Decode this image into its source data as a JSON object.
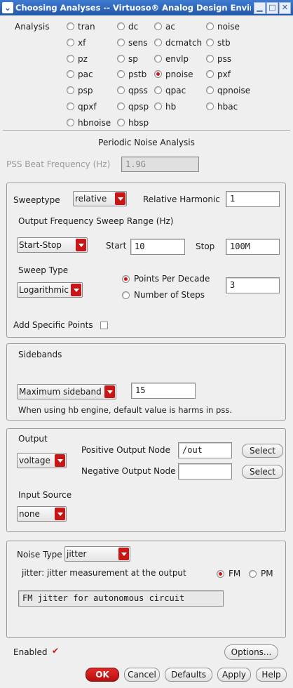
{
  "window": {
    "title": "Choosing Analyses -- Virtuoso® Analog Design Environment",
    "menu_icon": "chevron-down-icon",
    "btn_minimize": "▁",
    "btn_maximize": "□",
    "btn_close": "✕"
  },
  "analysis": {
    "label": "Analysis",
    "options": [
      "tran",
      "dc",
      "ac",
      "noise",
      "xf",
      "sens",
      "dcmatch",
      "stb",
      "pz",
      "sp",
      "envlp",
      "pss",
      "pac",
      "pstb",
      "pnoise",
      "pxf",
      "psp",
      "qpss",
      "qpac",
      "qpnoise",
      "qpxf",
      "qpsp",
      "hb",
      "hbac",
      "hbnoise",
      "hbsp"
    ],
    "selected": "pnoise"
  },
  "section_title": "Periodic Noise Analysis",
  "pss_beat": {
    "label": "PSS Beat Frequency (Hz)",
    "value": "1.9G"
  },
  "sweep": {
    "sweeptype_label": "Sweeptype",
    "sweeptype_value": "relative",
    "relative_harmonic_label": "Relative Harmonic",
    "relative_harmonic_value": "1",
    "range_label": "Output Frequency Sweep Range (Hz)",
    "range_mode": "Start-Stop",
    "start_label": "Start",
    "start_value": "10",
    "stop_label": "Stop",
    "stop_value": "100M",
    "sweep_type_label": "Sweep Type",
    "sweep_type_value": "Logarithmic",
    "points_per_decade_label": "Points Per Decade",
    "number_of_steps_label": "Number of Steps",
    "points_value": "3",
    "step_mode_selected": "points_per_decade",
    "add_points_label": "Add Specific Points",
    "add_points_checked": false
  },
  "sidebands": {
    "label": "Sidebands",
    "mode": "Maximum sideband",
    "value": "15",
    "note": "When using hb engine, default value is harms in pss."
  },
  "output": {
    "label": "Output",
    "type": "voltage",
    "pos_label": "Positive Output Node",
    "pos_value": "/out",
    "neg_label": "Negative Output Node",
    "neg_value": "",
    "select_label": "Select",
    "input_source_label": "Input Source",
    "input_source_value": "none"
  },
  "noise": {
    "type_label": "Noise Type",
    "type_value": "jitter",
    "description": "jitter: jitter measurement at the output",
    "fm_label": "FM",
    "pm_label": "PM",
    "modulation_selected": "FM",
    "note_field": "FM jitter for autonomous circuit"
  },
  "footer": {
    "enabled_label": "Enabled",
    "enabled_checked": true,
    "check_mark": "✔",
    "options_label": "Options...",
    "ok_label": "OK",
    "cancel_label": "Cancel",
    "defaults_label": "Defaults",
    "apply_label": "Apply",
    "help_label": "Help"
  },
  "colors": {
    "accent": "#c71616",
    "titlebar": "#2457a8"
  }
}
